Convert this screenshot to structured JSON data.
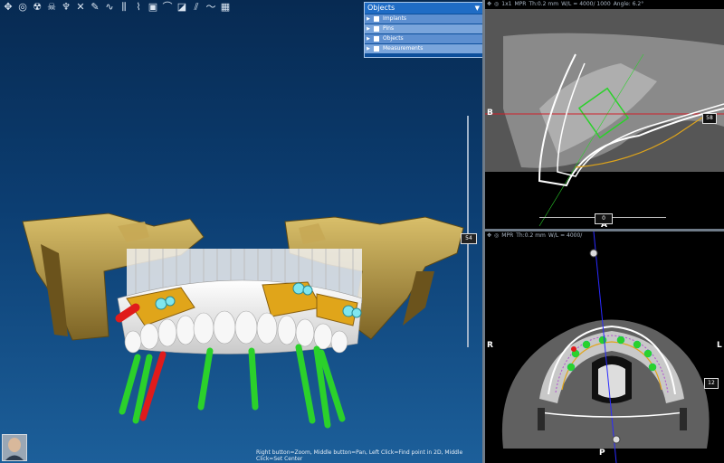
{
  "toolbar": {
    "icons": [
      "move-icon",
      "camera-icon",
      "radiation-icon",
      "skull-icon",
      "tooth-icon",
      "cross-icon",
      "pen-icon",
      "nerve-icon",
      "implant-row-icon",
      "toothbrush-icon",
      "image-icon",
      "arch-icon",
      "slice-icon",
      "lines-icon",
      "curve-icon",
      "grid-icon"
    ]
  },
  "objects_panel": {
    "title": "Objects",
    "items": [
      {
        "label": "Implants"
      },
      {
        "label": "Pins"
      },
      {
        "label": "Objects"
      },
      {
        "label": "Measurements"
      }
    ]
  },
  "view3d": {
    "slider_value": "54",
    "status_text": "Right button=Zoom, Middle button=Pan, Left Click=Find point in 2D, Middle Click=Set Center"
  },
  "mpr_top": {
    "header": {
      "mode": "1x1",
      "name": "MPR",
      "thickness": "Th:0.2 mm",
      "window": "W/L = 4000/ 1000",
      "angle": "Angle: 6.2°"
    },
    "left_label": "B",
    "bottom_label": "A",
    "h_value": "0",
    "v_value": "58"
  },
  "mpr_bottom": {
    "header": {
      "name": "MPR",
      "thickness": "Th:0.2 mm",
      "window": "W/L = 4000/"
    },
    "left_label": "R",
    "right_label": "L",
    "bottom_label": "P",
    "v_value": "12"
  },
  "colors": {
    "bone": "#b99a4e",
    "implant_green": "#2bd12b",
    "implant_red": "#e01b1b",
    "sleeve": "#e0a51a",
    "bg_top": "#072a52",
    "bg_bottom": "#1c5f9a"
  }
}
